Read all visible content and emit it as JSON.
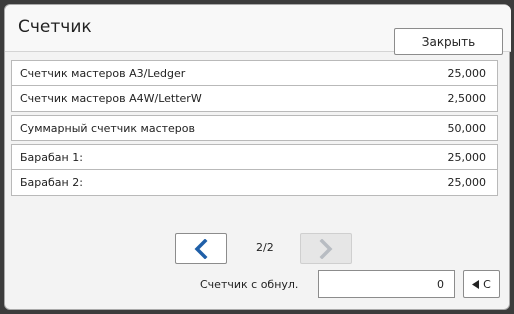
{
  "header": {
    "title": "Счетчик",
    "close_label": "Закрыть"
  },
  "counters": [
    {
      "label": "Счетчик мастеров A3/Ledger",
      "value": "25,000"
    },
    {
      "label": "Счетчик мастеров A4W/LetterW",
      "value": "2,5000"
    },
    {
      "label": "Суммарный счетчик мастеров",
      "value": "50,000"
    },
    {
      "label": "Барабан  1:",
      "value": "25,000"
    },
    {
      "label": "Барабан  2:",
      "value": "25,000"
    }
  ],
  "pagination": {
    "indicator": "2/2",
    "prev_icon": "chevron-left-icon",
    "next_icon": "chevron-right-icon",
    "next_disabled": true
  },
  "reset_counter": {
    "label": "Счетчик с обнул.",
    "value": "0",
    "clear_label": "C",
    "clear_icon": "triangle-left-icon"
  },
  "colors": {
    "accent": "#1f5fa8",
    "disabled": "#b8bcc2"
  }
}
